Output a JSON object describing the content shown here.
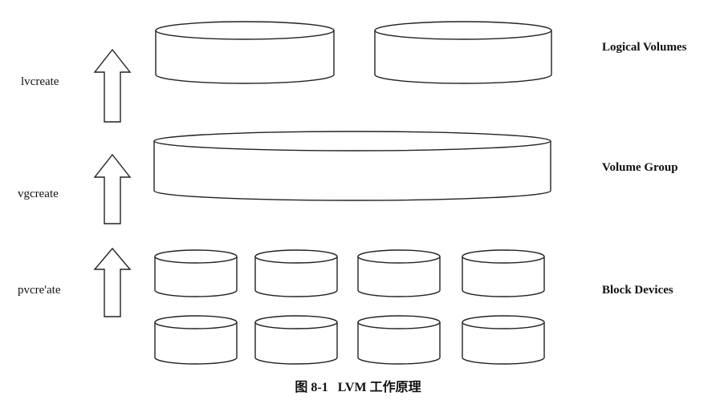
{
  "commands": {
    "lvcreate": "lvcreate",
    "vgcreate": "vgcreate",
    "pvcreate": "pvcre'ate"
  },
  "layers": {
    "logical_volumes": "Logical Volumes",
    "volume_group": "Volume Group",
    "block_devices": "Block Devices"
  },
  "caption": "图 8-1   LVM 工作原理"
}
